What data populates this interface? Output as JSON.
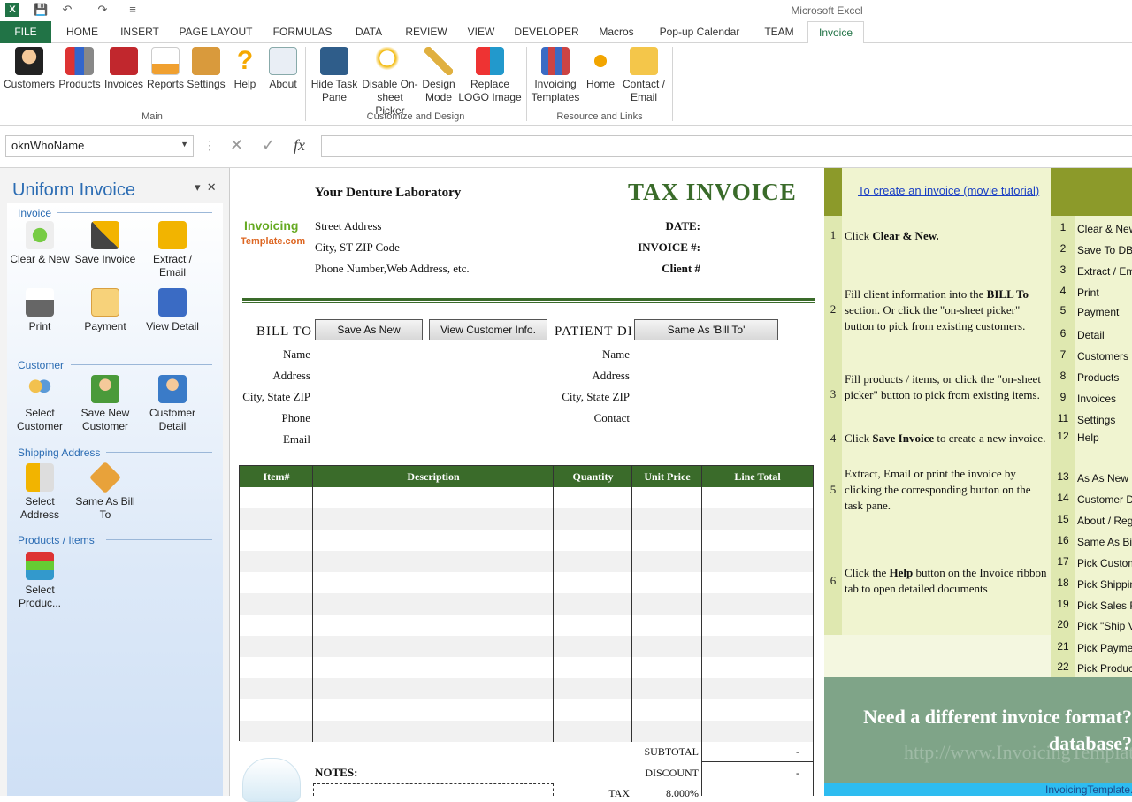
{
  "window": {
    "app_title": "Microsoft Excel"
  },
  "tabs": [
    "FILE",
    "HOME",
    "INSERT",
    "PAGE LAYOUT",
    "FORMULAS",
    "DATA",
    "REVIEW",
    "VIEW",
    "DEVELOPER",
    "Macros",
    "Pop-up Calendar",
    "TEAM",
    "Invoice"
  ],
  "ribbon": {
    "main": [
      "Customers",
      "Products",
      "Invoices",
      "Reports",
      "Settings",
      "Help",
      "About"
    ],
    "main_label": "Main",
    "customize": [
      [
        "Hide Task",
        "Pane"
      ],
      [
        "Disable On-",
        "sheet Picker"
      ],
      [
        "Design",
        "Mode"
      ],
      [
        "Replace",
        "LOGO Image"
      ]
    ],
    "customize_label": "Customize and Design",
    "resource": [
      [
        "Invoicing",
        "Templates"
      ],
      [
        "Home",
        ""
      ],
      [
        "Contact /",
        "Email"
      ]
    ],
    "resource_label": "Resource and Links"
  },
  "formula_bar": {
    "name_box": "oknWhoName",
    "fx": "fx"
  },
  "taskpane": {
    "title": "Uniform Invoice",
    "sections": {
      "invoice": "Invoice",
      "customer": "Customer",
      "shipping": "Shipping Address",
      "products": "Products / Items"
    },
    "invoice_btns": [
      [
        "Clear & New",
        ""
      ],
      [
        "Save Invoice",
        ""
      ],
      [
        "Extract /",
        "Email"
      ],
      [
        "Print",
        ""
      ],
      [
        "Payment",
        ""
      ],
      [
        "View Detail",
        ""
      ]
    ],
    "customer_btns": [
      [
        "Select",
        "Customer"
      ],
      [
        "Save New",
        "Customer"
      ],
      [
        "Customer",
        "Detail"
      ]
    ],
    "shipping_btns": [
      [
        "Select",
        "Address"
      ],
      [
        "Same As Bill",
        "To"
      ]
    ],
    "product_btns": [
      [
        "Select",
        "Produc..."
      ]
    ]
  },
  "invoice": {
    "company": "Your Denture Laboratory",
    "title": "TAX INVOICE",
    "logo_top": "Invoicing",
    "logo_bottom": "Template.com",
    "address": [
      "Street Address",
      "City, ST  ZIP Code",
      "Phone Number,Web Address, etc."
    ],
    "meta": [
      "DATE:",
      "INVOICE #:",
      "Client #"
    ],
    "bill_to": "BILL TO",
    "patient": "PATIENT DI",
    "btn_save_new": "Save As New",
    "btn_view_customer": "View Customer Info.",
    "btn_same_bill": "Same As 'Bill To'",
    "bill_fields": [
      "Name",
      "Address",
      "City, State ZIP",
      "Phone",
      "Email"
    ],
    "patient_fields": [
      "Name",
      "Address",
      "City, State ZIP",
      "Contact"
    ],
    "columns": [
      "Item#",
      "Description",
      "Quantity",
      "Unit Price",
      "Line Total"
    ],
    "notes": "NOTES:",
    "totals": [
      [
        "SUBTOTAL",
        "-"
      ],
      [
        "DISCOUNT",
        "-"
      ],
      [
        "TAX",
        "8.000%"
      ]
    ]
  },
  "help": {
    "link": "To create an invoice (movie tutorial)",
    "steps": [
      [
        "1",
        "Click ",
        "Clear & New.",
        ""
      ],
      [
        "2",
        "Fill client information into the ",
        "BILL To",
        " section. Or click the \"on-sheet picker\" button to pick from existing customers."
      ],
      [
        "3",
        "Fill products / items, or click the \"on-sheet picker\" button to pick from existing items.",
        "",
        ""
      ],
      [
        "4",
        "Click ",
        "Save Invoice",
        " to create a new invoice."
      ],
      [
        "5",
        "Extract, Email or print the invoice by clicking the corresponding button on the task pane.",
        "",
        ""
      ],
      [
        "6",
        "Click the ",
        "Help",
        " button on the Invoice ribbon tab to open detailed documents"
      ]
    ],
    "shortcuts": [
      [
        "1",
        "Clear & New"
      ],
      [
        "2",
        "Save To DB"
      ],
      [
        "3",
        "Extract / Email"
      ],
      [
        "4",
        "Print"
      ],
      [
        "5",
        "Payment"
      ],
      [
        "6",
        "Detail"
      ],
      [
        "7",
        "Customers"
      ],
      [
        "8",
        "Products"
      ],
      [
        "9",
        "Invoices"
      ],
      [
        "11",
        "Settings"
      ],
      [
        "12",
        "Help"
      ],
      [
        "13",
        "As As New"
      ],
      [
        "14",
        "Customer Detail"
      ],
      [
        "15",
        "About / Register"
      ],
      [
        "16",
        "Same As Bill To"
      ],
      [
        "17",
        "Pick Customer"
      ],
      [
        "18",
        "Pick Shipping"
      ],
      [
        "19",
        "Pick Sales Rep"
      ],
      [
        "20",
        "Pick \"Ship Via\""
      ],
      [
        "21",
        "Pick Payment"
      ],
      [
        "22",
        "Pick Product"
      ]
    ],
    "promo": "Need a different invoice format? database?",
    "promo_url": "http://www.InvoicingTemplate.com",
    "promo_bar": "InvoicingTemplate.com"
  }
}
